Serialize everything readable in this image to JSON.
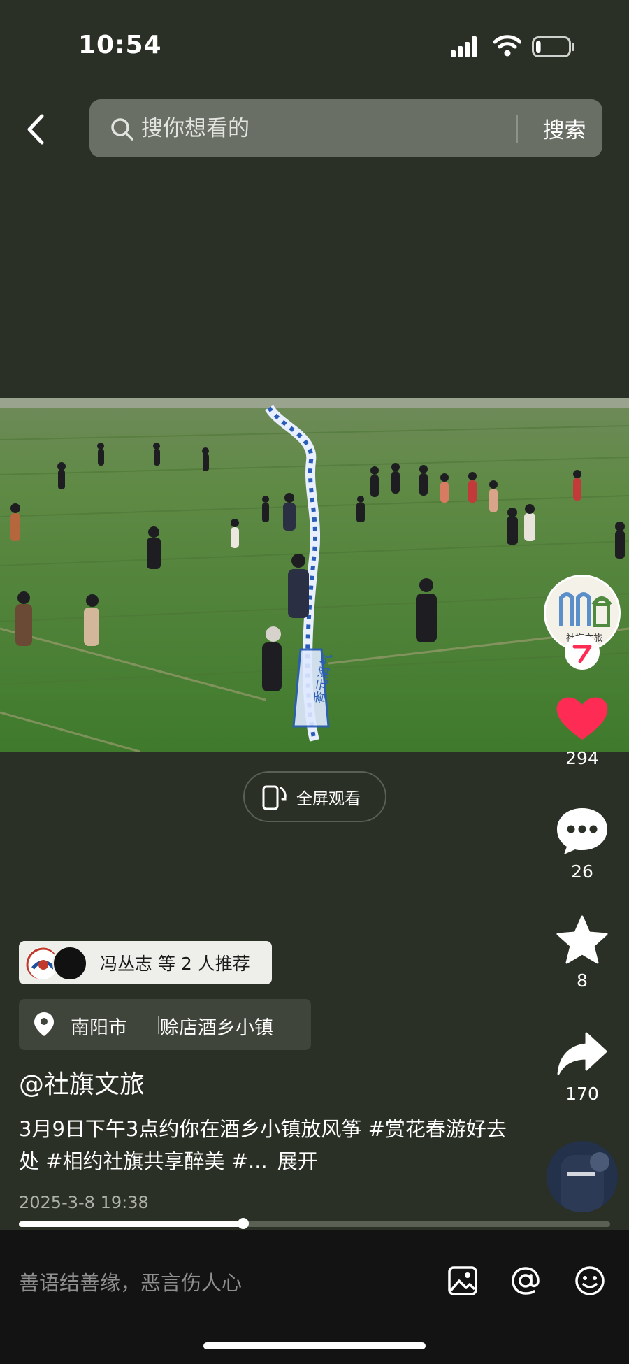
{
  "status_bar": {
    "time": "10:54",
    "icons": [
      "signal-icon",
      "wifi-icon",
      "battery-icon"
    ],
    "battery_level": 0.15
  },
  "search": {
    "placeholder": "搜你想看的",
    "button_label": "搜索"
  },
  "video": {
    "fullscreen_label": "全屏观看",
    "progress": 0.38,
    "kite_text": "香元清气"
  },
  "creator": {
    "avatar_text": "社旗文旅",
    "follow_icon": "plus-icon"
  },
  "actions": {
    "like_count": "294",
    "comment_count": "26",
    "favorite_count": "8",
    "share_count": "170",
    "colors": {
      "like": "#fe2c55",
      "default": "#ffffff"
    }
  },
  "recommend": {
    "label": "冯丛志 等 2 人推荐"
  },
  "location": {
    "city": "南阳市",
    "place": "赊店酒乡小镇"
  },
  "post": {
    "author": "@社旗文旅",
    "description": "3月9日下午3点约你在酒乡小镇放风筝 #赏花春游好去处 #相约社旗共享醉美 #...",
    "expand_label": "展开",
    "date": "2025-3-8 19:38"
  },
  "comment_bar": {
    "placeholder": "善语结善缘，恶言伤人心",
    "icons": [
      "image-icon",
      "mention-icon",
      "emoji-icon"
    ]
  }
}
